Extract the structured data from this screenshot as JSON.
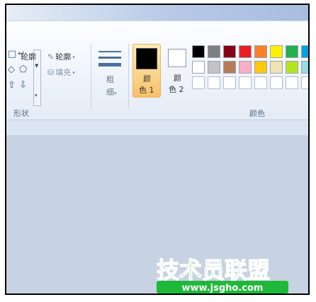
{
  "ribbon": {
    "shapes": {
      "outline_label": "轮廓",
      "fill_label": "填充",
      "group_label": "形状"
    },
    "size": {
      "label_1": "粗",
      "label_2": "细"
    },
    "colors": {
      "color1_line1": "颜",
      "color1_line2": "色 1",
      "color2_line1": "颜",
      "color2_line2": "色 2",
      "group_label": "颜色",
      "color1_value": "#000000",
      "color2_value": "#ffffff",
      "palette_row1": [
        "#000000",
        "#7f7f7f",
        "#880015",
        "#ed1c24",
        "#ff7f27",
        "#fff200",
        "#22b14c",
        "#00a2e8"
      ],
      "palette_row2": [
        "#ffffff",
        "#c3c3c3",
        "#b97a57",
        "#ffaec9",
        "#ffc90e",
        "#efe4b0",
        "#b5e61d",
        "#99d9ea"
      ]
    }
  },
  "watermark": {
    "title": "技术员联盟",
    "url": "www.jsgho.com"
  }
}
